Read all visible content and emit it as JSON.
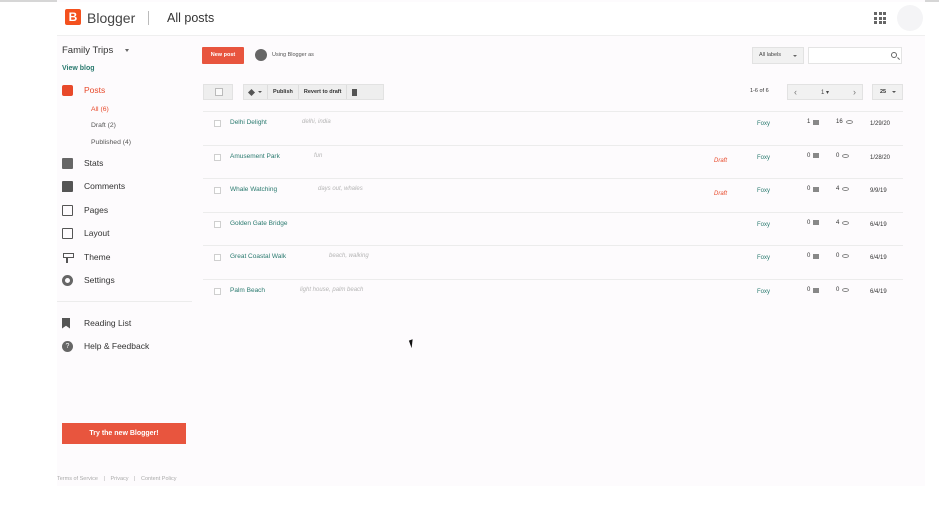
{
  "header": {
    "logo_letter": "B",
    "brand": "Blogger",
    "title": "All posts"
  },
  "sidebar": {
    "blog_name": "Family Trips",
    "view_blog": "View blog",
    "nav": [
      {
        "label": "Posts",
        "icon": "posts-icon"
      },
      {
        "label": "Stats",
        "icon": "stats-icon"
      },
      {
        "label": "Comments",
        "icon": "comments-icon"
      },
      {
        "label": "Pages",
        "icon": "pages-icon"
      },
      {
        "label": "Layout",
        "icon": "layout-icon"
      },
      {
        "label": "Theme",
        "icon": "theme-icon"
      },
      {
        "label": "Settings",
        "icon": "settings-icon"
      }
    ],
    "posts_sub": [
      "All (6)",
      "Draft (2)",
      "Published (4)"
    ],
    "secondary": [
      {
        "label": "Reading List",
        "icon": "bookmark-icon"
      },
      {
        "label": "Help & Feedback",
        "icon": "help-icon"
      }
    ],
    "try_button": "Try the new Blogger!",
    "footer_links": [
      "Terms of Service",
      "|",
      "Privacy",
      "|",
      "Content Policy"
    ]
  },
  "main": {
    "new_post": "New post",
    "using_as": "Using Blogger as",
    "labels_dropdown": "All labels",
    "toolbar": {
      "publish": "Publish",
      "revert": "Revert to draft"
    },
    "range": "1-6 of 6",
    "page": "1",
    "page_size": "25",
    "posts": [
      {
        "title": "Delhi Delight",
        "labels": "delhi, india",
        "status": "",
        "author": "Foxy",
        "comments": "1",
        "views": "16",
        "date": "1/29/20"
      },
      {
        "title": "Amusement Park",
        "labels": "fun",
        "status": "Draft",
        "author": "Foxy",
        "comments": "0",
        "views": "0",
        "date": "1/28/20"
      },
      {
        "title": "Whale Watching",
        "labels": "days out, whales",
        "status": "Draft",
        "author": "Foxy",
        "comments": "0",
        "views": "4",
        "date": "9/9/19"
      },
      {
        "title": "Golden Gate Bridge",
        "labels": "",
        "status": "",
        "author": "Foxy",
        "comments": "0",
        "views": "4",
        "date": "6/4/19"
      },
      {
        "title": "Great Coastal Walk",
        "labels": "beach, walking",
        "status": "",
        "author": "Foxy",
        "comments": "0",
        "views": "0",
        "date": "6/4/19"
      },
      {
        "title": "Palm Beach",
        "labels": "light house, palm beach",
        "status": "",
        "author": "Foxy",
        "comments": "0",
        "views": "0",
        "date": "6/4/19"
      }
    ]
  },
  "colors": {
    "accent": "#e8553e",
    "link": "#2a7a6f"
  }
}
